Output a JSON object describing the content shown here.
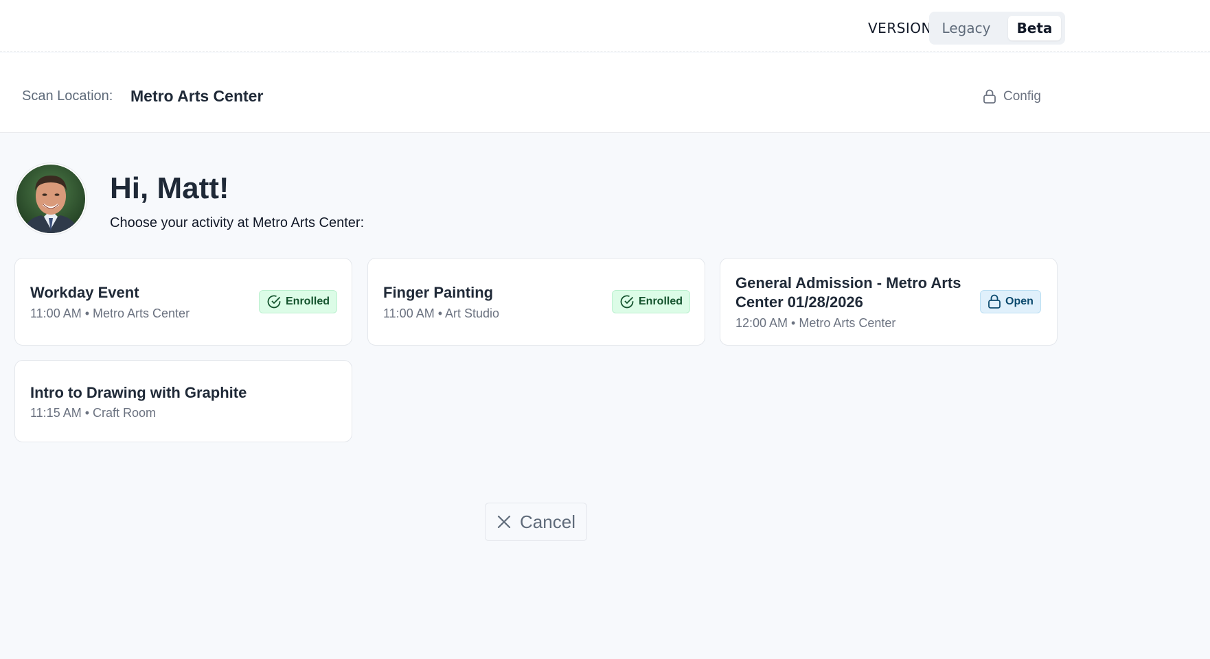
{
  "header": {
    "version_label": "VERSION:",
    "version_options": {
      "legacy": "Legacy",
      "beta": "Beta"
    },
    "selected_version": "Beta"
  },
  "location": {
    "label": "Scan Location:",
    "value": "Metro Arts Center",
    "config_label": "Config",
    "config_icon": "lock-icon"
  },
  "user": {
    "greeting": "Hi, Matt!",
    "prompt": "Choose your activity at Metro Arts Center:",
    "avatar_icon": "user-avatar"
  },
  "activities": [
    {
      "title": "Workday Event",
      "meta": "11:00 AM • Metro Arts Center",
      "status": "Enrolled",
      "status_icon": "check-circle-icon"
    },
    {
      "title": "Finger Painting",
      "meta": "11:00 AM • Art Studio",
      "status": "Enrolled",
      "status_icon": "check-circle-icon"
    },
    {
      "title_line1": "General Admission - Metro Arts",
      "title_line2": "Center 01/28/2026",
      "meta": "12:00 AM • Metro Arts Center",
      "status": "Open",
      "status_icon": "unlock-icon"
    },
    {
      "title": "Intro to Drawing with Graphite",
      "meta": "11:15 AM • Craft Room",
      "status": ""
    }
  ],
  "actions": {
    "cancel_label": "Cancel",
    "cancel_icon": "close-icon"
  },
  "colors": {
    "background": "#f7f9fc",
    "enrolled_bg": "#dcfce7",
    "enrolled_text": "#14532d",
    "open_bg": "#e0f0fb",
    "open_text": "#0c4a6e"
  }
}
